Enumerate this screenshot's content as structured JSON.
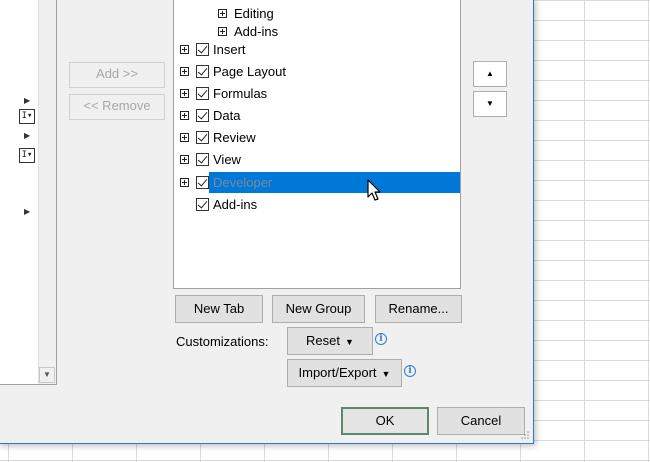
{
  "buttons": {
    "add": "Add >>",
    "remove": "<< Remove",
    "new_tab": "New Tab",
    "new_group": "New Group",
    "rename": "Rename...",
    "reset": "Reset",
    "import_export": "Import/Export",
    "ok": "OK",
    "cancel": "Cancel"
  },
  "labels": {
    "customizations": "Customizations:"
  },
  "tree": {
    "items": [
      {
        "label": "Editing",
        "checked": false,
        "expandable": true
      },
      {
        "label": "Add-ins",
        "checked": false,
        "expandable": true
      },
      {
        "label": "Insert",
        "checked": true,
        "expandable": true
      },
      {
        "label": "Page Layout",
        "checked": true,
        "expandable": true
      },
      {
        "label": "Formulas",
        "checked": true,
        "expandable": true
      },
      {
        "label": "Data",
        "checked": true,
        "expandable": true
      },
      {
        "label": "Review",
        "checked": true,
        "expandable": true
      },
      {
        "label": "View",
        "checked": true,
        "expandable": true
      },
      {
        "label": "Developer",
        "checked": true,
        "expandable": true,
        "selected": true
      },
      {
        "label": "Add-ins",
        "checked": true,
        "expandable": false
      }
    ]
  },
  "icons": {
    "move_up": "triangle-up-icon",
    "move_down": "triangle-down-icon",
    "info": "info-icon",
    "cursor": "mouse-pointer-icon",
    "dropdown": "triangle-down-icon"
  },
  "colors": {
    "selection": "#0078d7",
    "dialog_border": "#2b79d4",
    "info": "#2a7fd4"
  }
}
